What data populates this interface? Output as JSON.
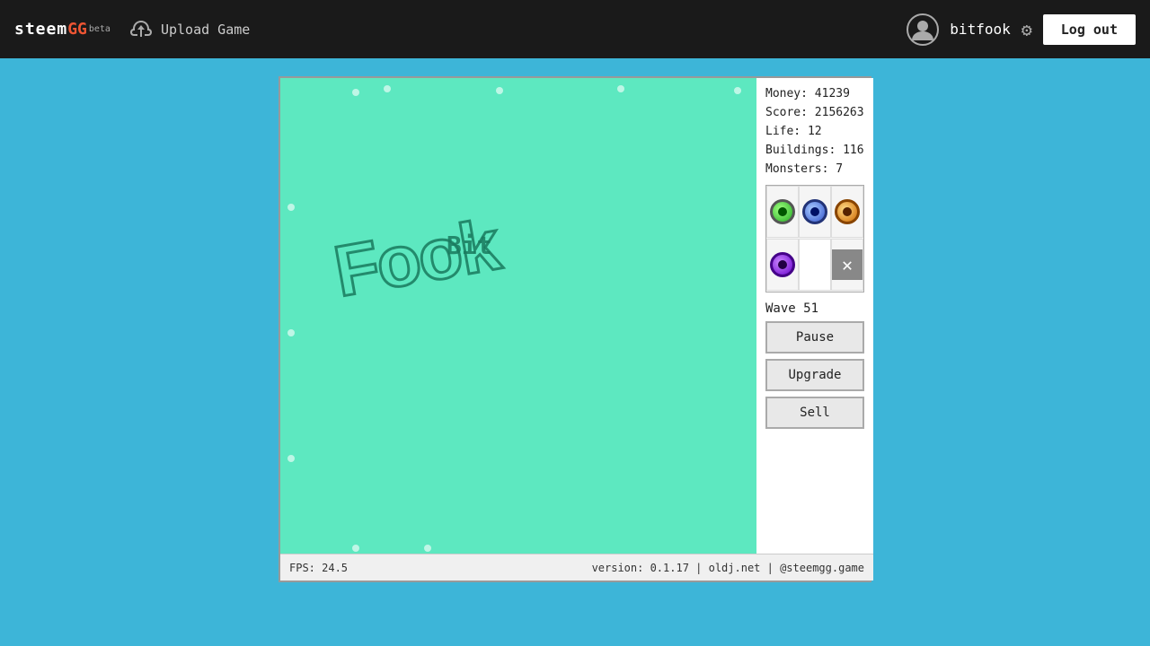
{
  "navbar": {
    "logo": {
      "steem": "steem",
      "gg": "GG",
      "beta": "beta"
    },
    "upload_label": "Upload Game",
    "username": "bitfook",
    "logout_label": "Log out"
  },
  "game": {
    "stats": {
      "money_label": "Money:",
      "money_value": "41239",
      "score_label": "Score:",
      "score_value": "2156263",
      "life_label": "Life:",
      "life_value": "12",
      "buildings_label": "Buildings:",
      "buildings_value": "116",
      "monsters_label": "Monsters:",
      "monsters_value": "7"
    },
    "wave_label": "Wave",
    "wave_number": "51",
    "buttons": {
      "pause": "Pause",
      "upgrade": "Upgrade",
      "sell": "Sell"
    },
    "title_text": "Fook",
    "bit_text": "Bit"
  },
  "statusbar": {
    "fps": "FPS: 24.5",
    "version": "version: 0.1.17 | oldj.net | @steemgg.game"
  }
}
